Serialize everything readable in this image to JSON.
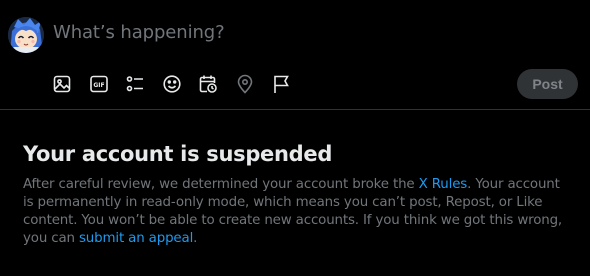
{
  "composer": {
    "placeholder": "What’s happening?",
    "toolbar": [
      "media-icon",
      "gif-icon",
      "poll-icon",
      "emoji-icon",
      "schedule-icon",
      "location-icon",
      "flag-icon"
    ],
    "gif_label": "GIF",
    "post_label": "Post"
  },
  "notice": {
    "title": "Your account is suspended",
    "text_1": "After careful review, we determined your account broke the ",
    "rules_link": "X Rules",
    "text_2": ". Your account is permanently in read-only mode, which means you can’t post, Repost, or Like content. You won’t be able to create new accounts. If you think we got this wrong, you can ",
    "appeal_link": "submit an appeal",
    "text_3": "."
  },
  "colors": {
    "background": "#000000",
    "text": "#e7e9ea",
    "muted": "#71767b",
    "link": "#1d9bf0",
    "divider": "#2f3336",
    "post_button_bg": "#2f3336"
  }
}
